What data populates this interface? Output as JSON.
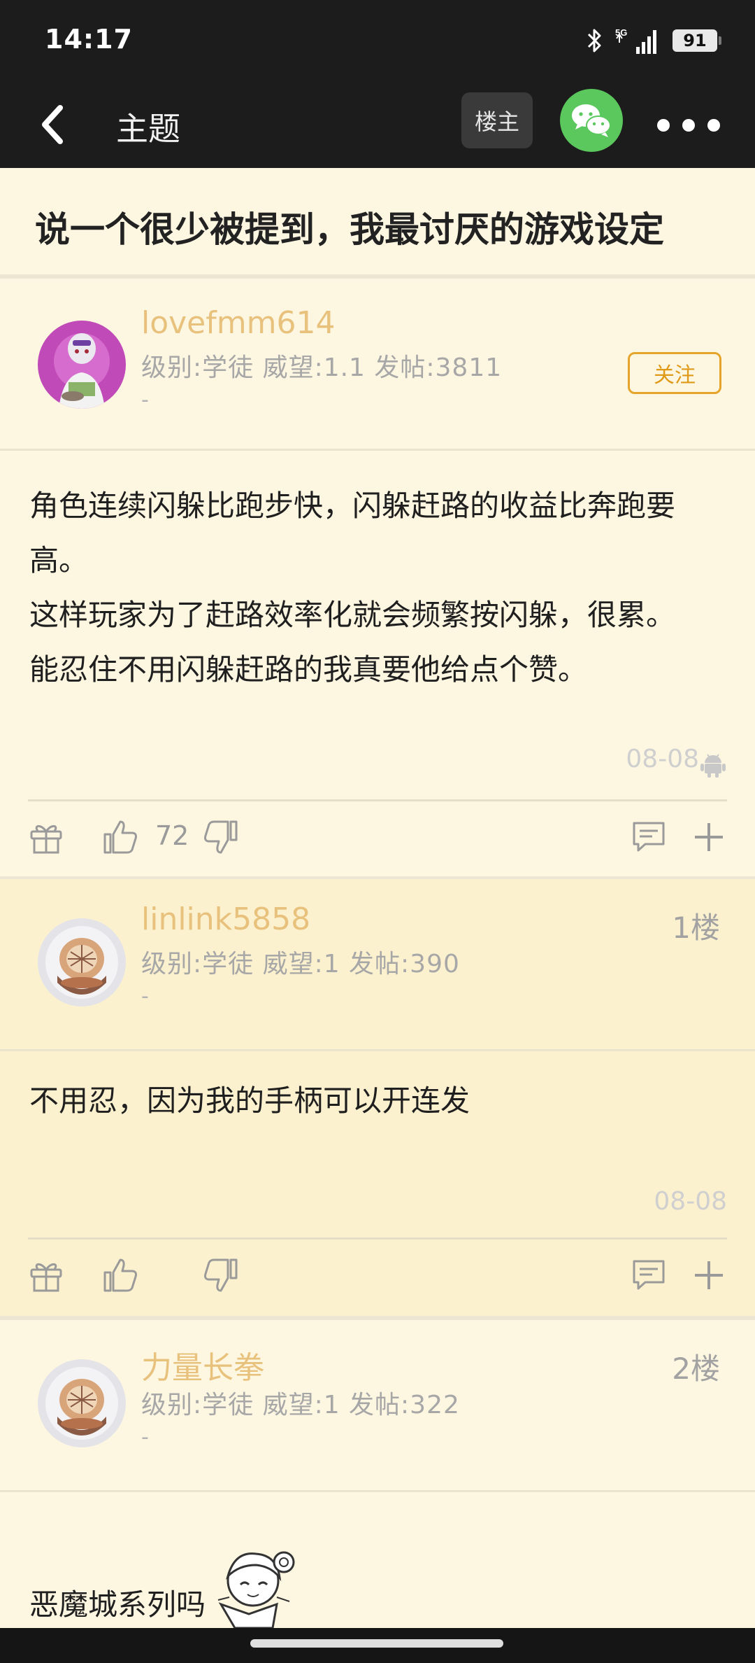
{
  "status_bar": {
    "time": "14:17",
    "network": "5G",
    "battery": "91"
  },
  "header": {
    "title": "主题",
    "op_button": "楼主"
  },
  "topic": {
    "title": "说一个很少被提到，我最讨厌的游戏设定"
  },
  "posts": [
    {
      "username": "lovefmm614",
      "meta": "级别:学徒 威望:1.1 发帖:3811",
      "sign": "-",
      "follow_label": "关注",
      "lines": [
        "角色连续闪躲比跑步快，闪躲赶路的收益比奔跑要",
        "高。",
        "这样玩家为了赶路效率化就会频繁按闪躲，很累。",
        "能忍住不用闪躲赶路的我真要他给点个赞。"
      ],
      "date": "08-08",
      "likes": "72"
    },
    {
      "username": "linlink5858",
      "meta": "级别:学徒 威望:1 发帖:390",
      "sign": "-",
      "floor": "1楼",
      "lines": [
        "不用忍，因为我的手柄可以开连发"
      ],
      "date": "08-08"
    },
    {
      "username": "力量长拳",
      "meta": "级别:学徒 威望:1 发帖:322",
      "sign": "-",
      "floor": "2楼",
      "lines": [
        "恶魔城系列吗"
      ]
    }
  ],
  "colors": {
    "accent_orange": "#e5a42a",
    "username": "#e8c17c",
    "wechat_green": "#5ac85c",
    "reply_bg": "#fcf1cf",
    "page_bg": "#fdf6e1"
  },
  "icons": [
    "back-icon",
    "wechat-icon",
    "more-icon",
    "gift-icon",
    "thumbs-up-icon",
    "thumbs-down-icon",
    "reply-icon",
    "plus-icon",
    "android-icon",
    "bluetooth-icon",
    "signal-icon"
  ]
}
